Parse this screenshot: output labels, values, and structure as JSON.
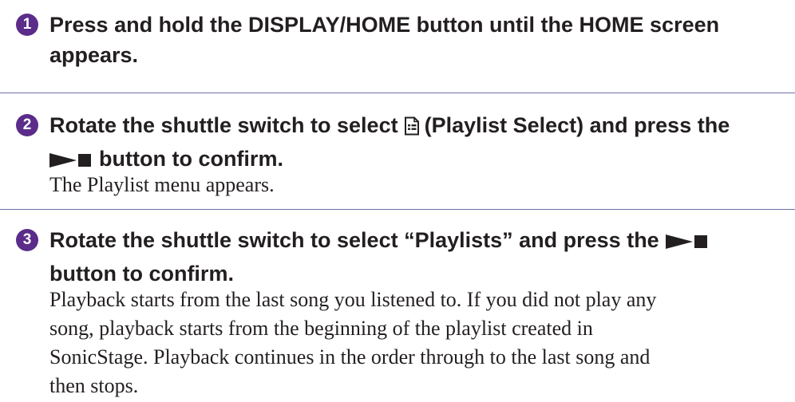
{
  "steps": [
    {
      "number": "1",
      "heading_line1": "Press and hold the DISPLAY/HOME button until the HOME screen",
      "heading_line2": "appears."
    },
    {
      "number": "2",
      "heading_line1_a": "Rotate the shuttle switch to select",
      "heading_line1_b": "(Playlist Select) and press the",
      "heading_line2": "button to confirm.",
      "body_lines": [
        "The Playlist menu appears."
      ]
    },
    {
      "number": "3",
      "heading_line1": "Rotate the shuttle switch to select “Playlists” and press the",
      "heading_line2": "button to confirm.",
      "body_lines": [
        "Playback starts from the last song you listened to. If you did not play any",
        "song, playback starts from the beginning of the playlist created in",
        "SonicStage. Playback continues in the order through to the last song and",
        "then stops."
      ]
    }
  ],
  "icons": {
    "playlist_select": "playlist-select-icon",
    "play_stop": "play-stop-icon"
  },
  "colors": {
    "badge": "#5b2c8a",
    "separator": "#6f70a8",
    "text": "#231f20"
  }
}
